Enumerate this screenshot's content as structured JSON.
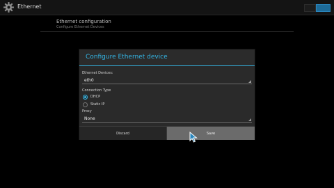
{
  "actionbar": {
    "icon": "gear-icon",
    "title": "Ethernet"
  },
  "section": {
    "title": "Ethernet configuration",
    "subtitle": "Configure Ethernet Devices"
  },
  "dialog": {
    "title": "Configure Ethernet device",
    "devices_label": "Ethernet Devices:",
    "device_value": "eth0",
    "connection_type_label": "Connection Type",
    "options": [
      "DHCP",
      "Static IP"
    ],
    "selected_option": "DHCP",
    "proxy_label": "Proxy",
    "proxy_value": "None",
    "discard_label": "Discard",
    "save_label": "Save"
  },
  "colors": {
    "accent": "#33b5e5",
    "background": "#000000",
    "dialog": "#2a2a2a"
  }
}
